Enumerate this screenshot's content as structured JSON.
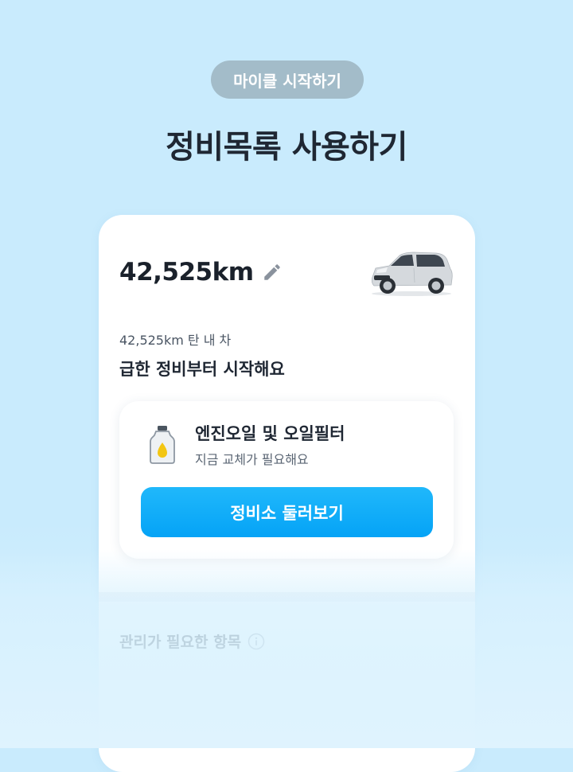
{
  "promo": {
    "badge": "마이클 시작하기",
    "headline": "정비목록 사용하기"
  },
  "card": {
    "odometer": "42,525km",
    "edit_icon": "pencil-icon",
    "car_image": "silver-suv-car",
    "caption": "42,525km 탄 내 차",
    "subheadline": "급한 정비부터 시작해요",
    "maintenance_item": {
      "icon": "engine-oil-bottle-icon",
      "title": "엔진오일 및 오일필터",
      "status": "지금 교체가 필요해요",
      "button_label": "정비소 둘러보기"
    },
    "section_title": "관리가 필요한 항목",
    "section_icon": "info-icon"
  },
  "colors": {
    "background": "#c9ebfd",
    "badge": "#a3bcc9",
    "button": "#05a3f6",
    "oil": "#f3c613"
  }
}
